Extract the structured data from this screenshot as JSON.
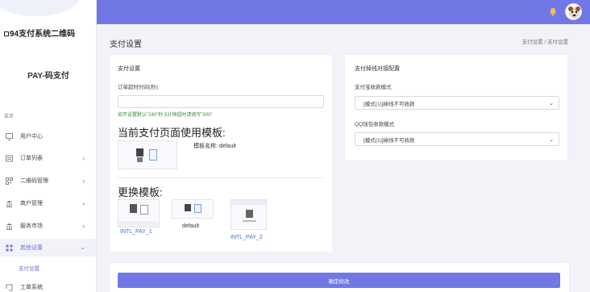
{
  "brand": {
    "title": "94支付系统二维码",
    "app_name": "PAY-码支付"
  },
  "sidebar": {
    "caption": "菜单",
    "items": [
      {
        "label": "用户中心",
        "icon": "monitor-icon",
        "has_arrow": false
      },
      {
        "label": "订单列表",
        "icon": "list-icon",
        "has_arrow": true
      },
      {
        "label": "二维码管理",
        "icon": "qrcode-icon",
        "has_arrow": true
      },
      {
        "label": "商户管理",
        "icon": "store-icon",
        "has_arrow": true
      },
      {
        "label": "服务市场",
        "icon": "market-icon",
        "has_arrow": true
      },
      {
        "label": "其他设置",
        "icon": "grid-icon",
        "has_arrow": true,
        "active": true
      },
      {
        "label": "工单系统",
        "icon": "ticket-icon",
        "has_arrow": false
      }
    ],
    "sub_items": [
      {
        "label": "支付设置"
      }
    ]
  },
  "header": {
    "title": "支付设置",
    "breadcrumb": "支付设置 / 支付设置"
  },
  "left_card": {
    "title": "支付设置",
    "timeout_label": "订单超时时间(秒):",
    "timeout_value": "",
    "timeout_hint": "如不设置默认\"240\"秒,5分钟超时请填写\"300\"",
    "current_template_heading": "当前支付页面使用模板:",
    "template_name_label": "模板名称: default",
    "change_template_heading": "更换模板:",
    "templates": [
      {
        "name": "INTL_PAY_1"
      },
      {
        "name": "default"
      },
      {
        "name": "INTL_PAY_2"
      }
    ]
  },
  "right_card": {
    "title": "支付掉线对接配置",
    "alipay_label": "支付宝收款模式",
    "alipay_selected": "[模式(1)]掉线不可收款",
    "qq_label": "QQ钱包收款模式",
    "qq_selected": "[模式(1)]掉线不可收款"
  },
  "submit_label": "确定修改",
  "colors": {
    "accent": "#7178e6",
    "hint_green": "#3c8b3c",
    "link_blue": "#3a6fcf"
  }
}
